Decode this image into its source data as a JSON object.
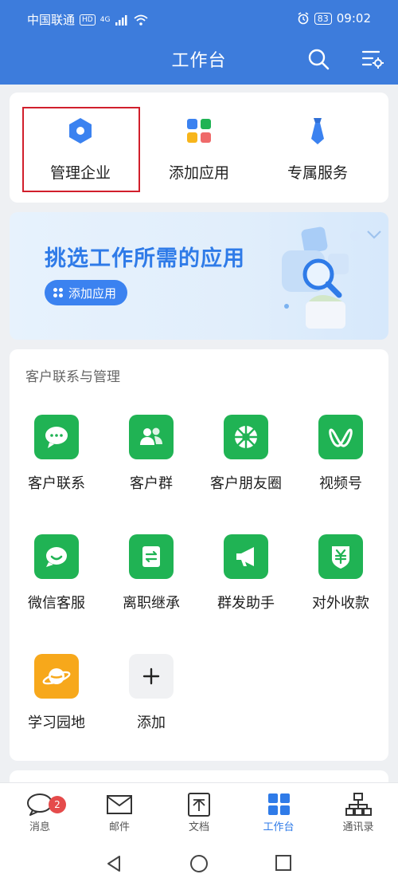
{
  "status_bar": {
    "carrier": "中国联通",
    "hd_tag": "HD",
    "network": "4G",
    "battery": "83",
    "time": "09:02"
  },
  "header": {
    "title": "工作台",
    "icons": [
      "search-icon",
      "settings-list-icon"
    ]
  },
  "quick_actions": [
    {
      "label": "管理企业",
      "icon": "hexagon-icon"
    },
    {
      "label": "添加应用",
      "icon": "app-grid-icon"
    },
    {
      "label": "专属服务",
      "icon": "tie-icon"
    }
  ],
  "banner": {
    "title": "挑选工作所需的应用",
    "button_label": "添加应用"
  },
  "customer_section": {
    "title": "客户联系与管理",
    "apps": [
      {
        "label": "客户联系",
        "icon": "chat-bubble-icon"
      },
      {
        "label": "客户群",
        "icon": "group-people-icon"
      },
      {
        "label": "客户朋友圈",
        "icon": "aperture-icon"
      },
      {
        "label": "视频号",
        "icon": "video-channel-icon"
      },
      {
        "label": "微信客服",
        "icon": "service-chat-icon"
      },
      {
        "label": "离职继承",
        "icon": "transfer-icon"
      },
      {
        "label": "群发助手",
        "icon": "megaphone-icon"
      },
      {
        "label": "对外收款",
        "icon": "yuan-shield-icon"
      },
      {
        "label": "学习园地",
        "icon": "planet-icon"
      },
      {
        "label": "添加",
        "icon": "plus-icon"
      }
    ]
  },
  "bottom_nav": {
    "items": [
      {
        "label": "消息",
        "icon": "message-icon",
        "badge": "2"
      },
      {
        "label": "邮件",
        "icon": "mail-icon"
      },
      {
        "label": "文档",
        "icon": "document-icon"
      },
      {
        "label": "工作台",
        "icon": "workbench-icon"
      },
      {
        "label": "通讯录",
        "icon": "contacts-icon"
      }
    ]
  },
  "colors": {
    "header_blue": "#3d7cdc",
    "accent_blue": "#2f7be8",
    "app_green": "#20b354",
    "highlight_red": "#d11f2c"
  }
}
